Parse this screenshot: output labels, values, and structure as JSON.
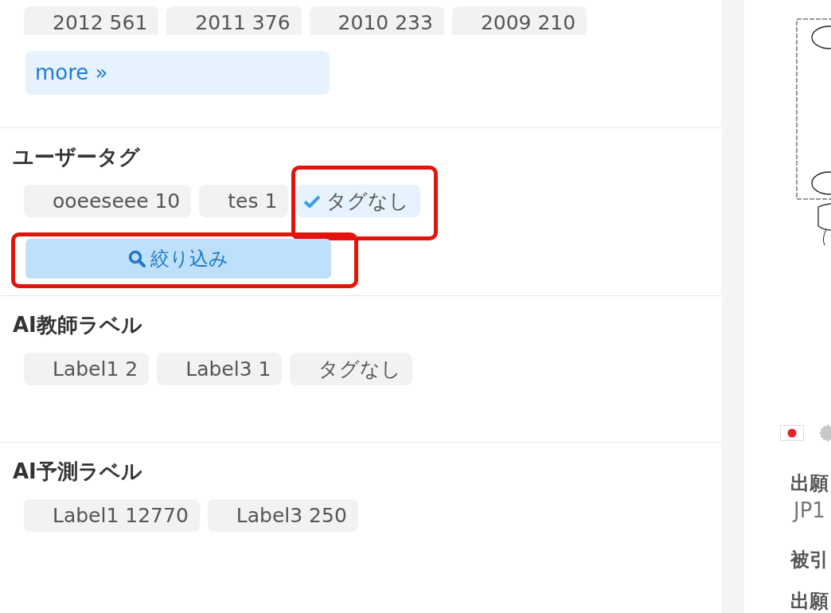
{
  "facet_panel": {
    "year_filter": {
      "chips": [
        {
          "label": "2012 561",
          "selected": false,
          "highlighted": false
        },
        {
          "label": "2011 376",
          "selected": false,
          "highlighted": false
        },
        {
          "label": "2010 233",
          "selected": false,
          "highlighted": false
        },
        {
          "label": "2009 210",
          "selected": false,
          "highlighted": false
        }
      ],
      "more_link": "more »"
    },
    "sections": [
      {
        "heading": "ユーザータグ",
        "chips": [
          {
            "label": "ooeeseee 10",
            "selected": false,
            "highlighted": false
          },
          {
            "label": "tes 1",
            "selected": false,
            "highlighted": false
          },
          {
            "label": "タグなし",
            "selected": true,
            "highlighted": true
          }
        ],
        "filter_button": {
          "label": "絞り込み",
          "highlighted": true
        }
      },
      {
        "heading": "AI教師ラベル",
        "chips": [
          {
            "label": "Label1 2",
            "selected": false,
            "highlighted": false
          },
          {
            "label": "Label3 1",
            "selected": false,
            "highlighted": false
          },
          {
            "label": "タグなし",
            "selected": false,
            "highlighted": false
          }
        ]
      },
      {
        "heading": "AI予測ラベル",
        "chips": [
          {
            "label": "Label1 12770",
            "selected": false,
            "highlighted": false
          },
          {
            "label": "Label3 250",
            "selected": false,
            "highlighted": false
          }
        ]
      }
    ]
  },
  "detail_panel": {
    "fields": [
      {
        "kind": "label",
        "text": "出願"
      },
      {
        "kind": "value",
        "text": "JP1"
      },
      {
        "kind": "label",
        "text": "被引"
      },
      {
        "kind": "label",
        "text": "出願"
      }
    ]
  }
}
